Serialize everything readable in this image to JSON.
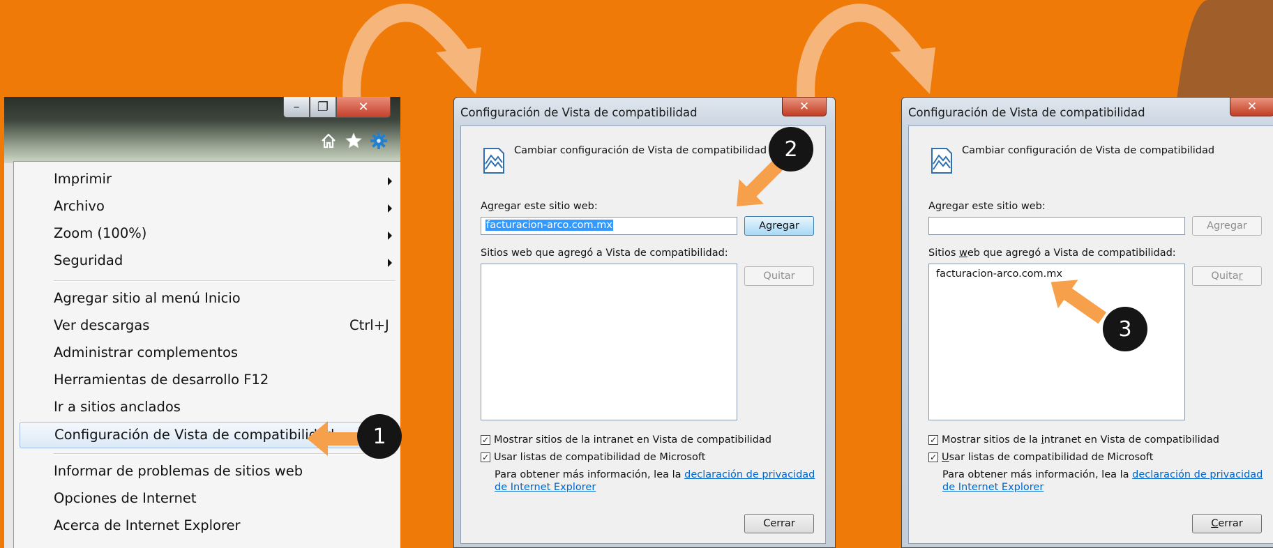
{
  "menu": {
    "items": [
      {
        "label": "Imprimir",
        "submenu": true
      },
      {
        "label": "Archivo",
        "submenu": true
      },
      {
        "label": "Zoom (100%)",
        "submenu": true
      },
      {
        "label": "Seguridad",
        "submenu": true
      },
      {
        "label": "Agregar sitio al menú Inicio"
      },
      {
        "label": "Ver descargas",
        "shortcut": "Ctrl+J"
      },
      {
        "label": "Administrar complementos"
      },
      {
        "label": "Herramientas de desarrollo F12"
      },
      {
        "label": "Ir a sitios anclados"
      },
      {
        "label": "Configuración de Vista de compatibilidad",
        "highlighted": true
      },
      {
        "label": "Informar de problemas de sitios web"
      },
      {
        "label": "Opciones de Internet"
      },
      {
        "label": "Acerca de Internet Explorer"
      }
    ],
    "toolbar_icons": [
      "home-icon",
      "star-icon",
      "gear-icon"
    ],
    "window_buttons": [
      "minimize-icon",
      "restore-icon",
      "close-icon"
    ]
  },
  "dialog": {
    "title": "Configuración de Vista de compatibilidad",
    "header": "Cambiar configuración de Vista de compatibilidad",
    "add_label": "Agregar este sitio web:",
    "add_label_plain_a": "A",
    "add_label_u": "g",
    "add_label_rest": "regar este sitio web:",
    "add_button": "Agregar",
    "add_button_a": "A",
    "add_button_u": "g",
    "add_button_rest": "regar",
    "sites_label": "Sitios web que agregó a Vista de compatibilidad:",
    "sites_label_a": "Sitios ",
    "sites_label_u": "w",
    "sites_label_rest": "eb que agregó a Vista de compatibilidad:",
    "remove_button": "Quitar",
    "remove_button_a": "Quita",
    "remove_button_u": "r",
    "intranet_checkbox": "Mostrar sitios de la intranet en Vista de compatibilidad",
    "intranet_a": "Mostrar sitios de la ",
    "intranet_u": "i",
    "intranet_rest": "ntranet en Vista de compatibilidad",
    "microsoft_checkbox": "Usar listas de compatibilidad de Microsoft",
    "microsoft_u": "U",
    "microsoft_rest": "sar listas de compatibilidad de Microsoft",
    "info_text": "Para obtener más información, lea la ",
    "info_link": "declaración de privacidad de Internet Explorer",
    "close_button": "Cerrar",
    "close_u": "C",
    "close_rest": "errar"
  },
  "dialog_before": {
    "input_value": "facturacion-arco.com.mx",
    "sites": []
  },
  "dialog_after": {
    "input_value": "",
    "sites": [
      "facturacion-arco.com.mx"
    ]
  },
  "callouts": {
    "step1": "1",
    "step2": "2",
    "step3": "3",
    "arrow_color": "#f7a04b",
    "badge_color": "#151515"
  },
  "colors": {
    "background": "#f07a08",
    "accent_brown": "#a05f2a",
    "selection": "#3399ff",
    "link": "#0066cc"
  }
}
